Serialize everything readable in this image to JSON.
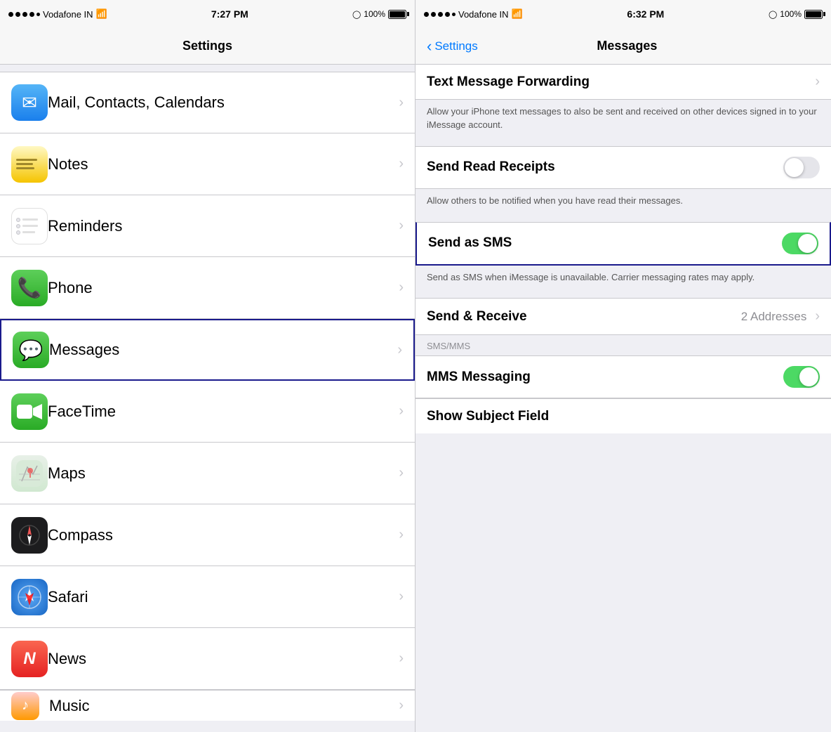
{
  "left_panel": {
    "status_bar": {
      "carrier": "Vodafone IN",
      "wifi": "WiFi",
      "time": "7:27 PM",
      "battery_icon": "⊙",
      "battery_pct": "100%"
    },
    "nav_title": "Settings",
    "items": [
      {
        "id": "mail",
        "label": "Mail, Contacts, Calendars",
        "icon_type": "mail",
        "highlighted": false
      },
      {
        "id": "notes",
        "label": "Notes",
        "icon_type": "notes",
        "highlighted": false
      },
      {
        "id": "reminders",
        "label": "Reminders",
        "icon_type": "reminders",
        "highlighted": false
      },
      {
        "id": "phone",
        "label": "Phone",
        "icon_type": "phone",
        "highlighted": false
      },
      {
        "id": "messages",
        "label": "Messages",
        "icon_type": "messages",
        "highlighted": true
      },
      {
        "id": "facetime",
        "label": "FaceTime",
        "icon_type": "facetime",
        "highlighted": false
      },
      {
        "id": "maps",
        "label": "Maps",
        "icon_type": "maps",
        "highlighted": false
      },
      {
        "id": "compass",
        "label": "Compass",
        "icon_type": "compass",
        "highlighted": false
      },
      {
        "id": "safari",
        "label": "Safari",
        "icon_type": "safari",
        "highlighted": false
      },
      {
        "id": "news",
        "label": "News",
        "icon_type": "news",
        "highlighted": false
      }
    ],
    "partial_item": "Music"
  },
  "right_panel": {
    "status_bar": {
      "carrier": "Vodafone IN",
      "wifi": "WiFi",
      "time": "6:32 PM",
      "battery_pct": "100%"
    },
    "back_label": "Settings",
    "nav_title": "Messages",
    "rows": [
      {
        "id": "text_message_forwarding",
        "title": "Text Message Forwarding",
        "type": "chevron",
        "partial": true
      },
      {
        "id": "forwarding_description",
        "type": "description",
        "text": "Allow your iPhone text messages to also be sent and received on other devices signed in to your iMessage account."
      },
      {
        "id": "send_read_receipts",
        "title": "Send Read Receipts",
        "type": "toggle",
        "toggle_on": false
      },
      {
        "id": "read_receipts_description",
        "type": "description",
        "text": "Allow others to be notified when you have read their messages."
      },
      {
        "id": "send_as_sms",
        "title": "Send as SMS",
        "type": "toggle",
        "toggle_on": true,
        "highlighted": true
      },
      {
        "id": "send_as_sms_description",
        "type": "description",
        "text": "Send as SMS when iMessage is unavailable. Carrier messaging rates may apply."
      },
      {
        "id": "send_receive",
        "title": "Send & Receive",
        "type": "value_chevron",
        "value": "2 Addresses"
      },
      {
        "id": "sms_mms_header",
        "type": "section_header",
        "text": "SMS/MMS"
      },
      {
        "id": "mms_messaging",
        "title": "MMS Messaging",
        "type": "toggle",
        "toggle_on": true
      }
    ],
    "partial_row": {
      "title": "Show Subject Field",
      "type": "toggle_partial"
    }
  }
}
